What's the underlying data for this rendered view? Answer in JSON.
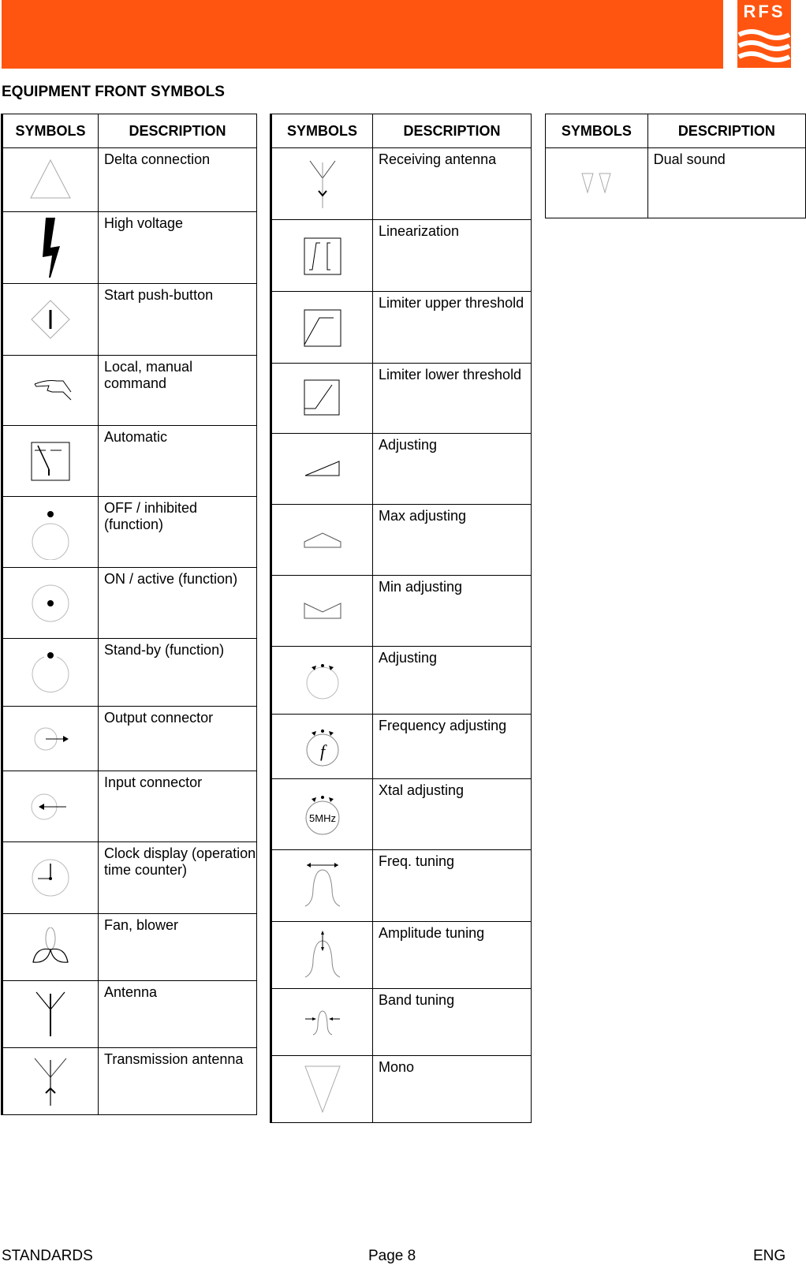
{
  "header": {
    "banner_color": "#ff5510",
    "logo_text": "RFS"
  },
  "page_title": "EQUIPMENT FRONT SYMBOLS",
  "tables": [
    {
      "headers": {
        "symbols": "SYMBOLS",
        "description": "DESCRIPTION"
      },
      "rows": [
        {
          "icon": "delta-triangle-icon",
          "description": "Delta connection"
        },
        {
          "icon": "high-voltage-icon",
          "description": "High voltage"
        },
        {
          "icon": "start-push-button-icon",
          "description": "Start push-button"
        },
        {
          "icon": "hand-icon",
          "description": "Local, manual command"
        },
        {
          "icon": "automatic-switch-icon",
          "description": "Automatic"
        },
        {
          "icon": "off-inhibited-icon",
          "description": "OFF / inhibited (function)"
        },
        {
          "icon": "on-active-icon",
          "description": "ON / active (function)"
        },
        {
          "icon": "standby-icon",
          "description": "Stand-by (function)"
        },
        {
          "icon": "output-connector-icon",
          "description": "Output connector"
        },
        {
          "icon": "input-connector-icon",
          "description": "Input connector"
        },
        {
          "icon": "clock-icon",
          "description": "Clock display (operation time counter)"
        },
        {
          "icon": "fan-icon",
          "description": "Fan, blower"
        },
        {
          "icon": "antenna-icon",
          "description": "Antenna"
        },
        {
          "icon": "transmission-antenna-icon",
          "description": "Transmission antenna"
        }
      ]
    },
    {
      "headers": {
        "symbols": "SYMBOLS",
        "description": "DESCRIPTION"
      },
      "rows": [
        {
          "icon": "receiving-antenna-icon",
          "description": "Receiving antenna"
        },
        {
          "icon": "linearization-icon",
          "description": "Linearization"
        },
        {
          "icon": "limiter-upper-icon",
          "description": "Limiter upper threshold"
        },
        {
          "icon": "limiter-lower-icon",
          "description": "Limiter lower threshold"
        },
        {
          "icon": "adjusting-wedge-icon",
          "description": "Adjusting"
        },
        {
          "icon": "max-adjusting-icon",
          "description": "Max adjusting"
        },
        {
          "icon": "min-adjusting-icon",
          "description": "Min adjusting"
        },
        {
          "icon": "adjusting-knob-icon",
          "description": "Adjusting"
        },
        {
          "icon": "frequency-knob-icon",
          "description": "Frequency adjusting",
          "label": "f"
        },
        {
          "icon": "xtal-knob-icon",
          "description": "Xtal adjusting",
          "label": "5MHz"
        },
        {
          "icon": "freq-tuning-icon",
          "description": "Freq. tuning"
        },
        {
          "icon": "amplitude-tuning-icon",
          "description": "Amplitude tuning"
        },
        {
          "icon": "band-tuning-icon",
          "description": "Band tuning"
        },
        {
          "icon": "mono-icon",
          "description": "Mono"
        }
      ]
    },
    {
      "headers": {
        "symbols": "SYMBOLS",
        "description": "DESCRIPTION"
      },
      "rows": [
        {
          "icon": "dual-sound-icon",
          "description": "Dual sound"
        }
      ]
    }
  ],
  "footer": {
    "left": "STANDARDS",
    "center": "Page 8",
    "right": "ENG"
  }
}
